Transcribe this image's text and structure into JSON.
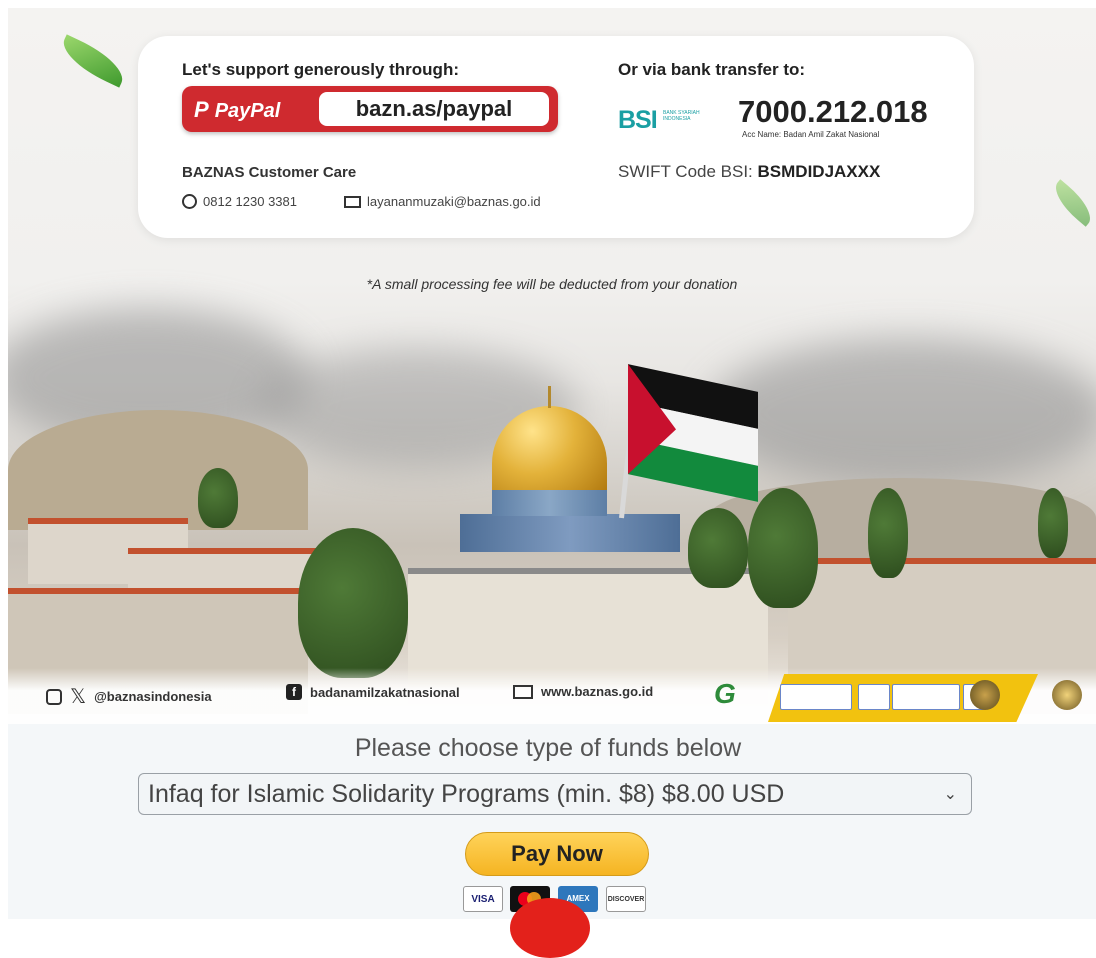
{
  "banner": {
    "support_title": "Let's support generously through:",
    "paypal_brand": "PayPal",
    "paypal_url": "bazn.as/paypal",
    "bank_title": "Or via bank transfer to:",
    "bank_logo": "BSI",
    "bank_logo_sub": "BANK SYARIAH INDONESIA",
    "account_number": "7000.212.018",
    "account_name": "Acc Name: Badan Amil Zakat Nasional",
    "swift_label": "SWIFT Code BSI:",
    "swift_code": "BSMDIDJAXXX",
    "customer_care_title": "BAZNAS Customer Care",
    "phone": "0812 1230 3381",
    "email": "layananmuzaki@baznas.go.id",
    "fee_note": "*A small processing fee will be deducted from your donation",
    "social_handle": "@baznasindonesia",
    "facebook": "badanamilzakatnasional",
    "website": "www.baznas.go.id",
    "colors": {
      "paypal_red": "#cf2a2f",
      "bsi_teal": "#1a9fa3",
      "cert_yellow": "#f2c20f"
    }
  },
  "form": {
    "choose_label": "Please choose type of funds below",
    "selected_fund": "Infaq for Islamic Solidarity Programs (min. $8) $8.00 USD",
    "pay_button": "Pay Now",
    "card_logos": [
      "VISA",
      "MC",
      "AMEX",
      "DISCOVER"
    ]
  }
}
